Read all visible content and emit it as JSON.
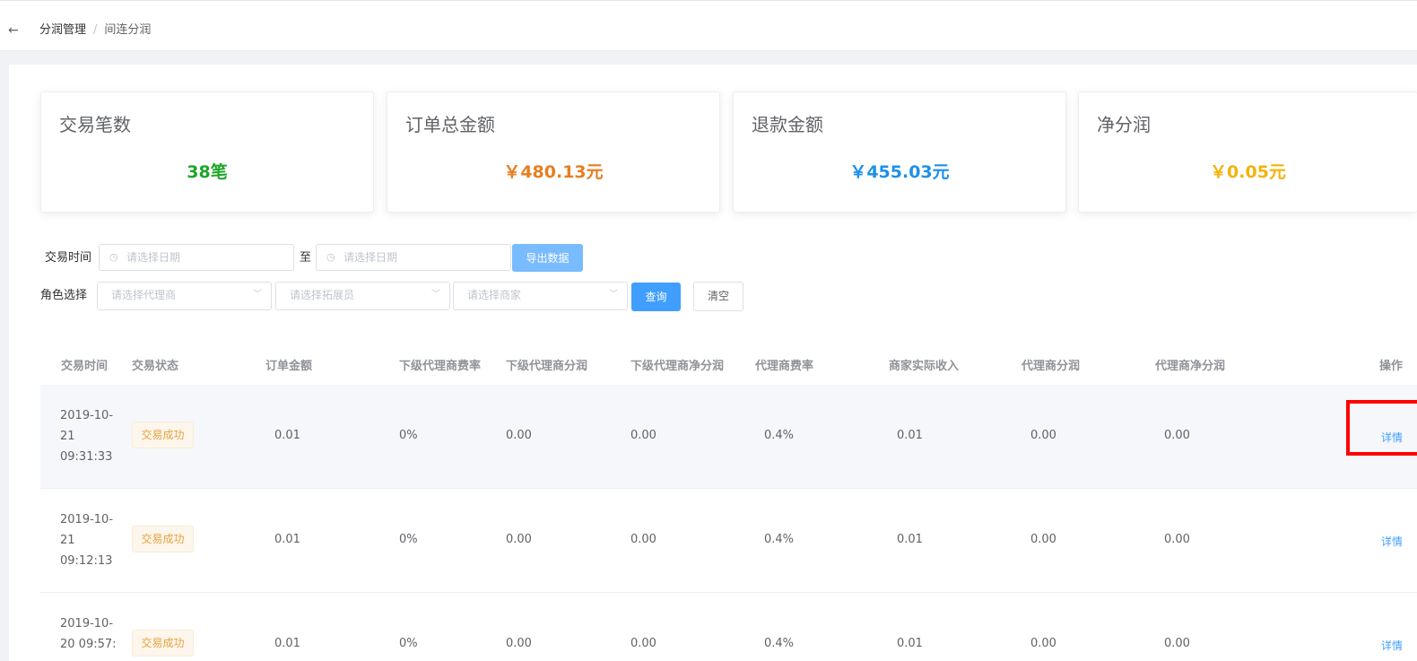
{
  "breadcrumb": {
    "back_icon": "←",
    "parent": "分润管理",
    "separator": "/",
    "current": "间连分润"
  },
  "stats": [
    {
      "title": "交易笔数",
      "value": "38笔",
      "color": "#1ca626"
    },
    {
      "title": "订单总金额",
      "value": "￥480.13元",
      "color": "#e67e22"
    },
    {
      "title": "退款金额",
      "value": "￥455.03元",
      "color": "#1e90e8"
    },
    {
      "title": "净分润",
      "value": "￥0.05元",
      "color": "#f2b30c"
    }
  ],
  "filters": {
    "time_label": "交易时间",
    "start_placeholder": "请选择日期",
    "to_label": "至",
    "end_placeholder": "请选择日期",
    "export_label": "导出数据",
    "role_label": "角色选择",
    "agent_placeholder": "请选择代理商",
    "promoter_placeholder": "请选择拓展员",
    "merchant_placeholder": "请选择商家",
    "query_label": "查询",
    "clear_label": "清空"
  },
  "table": {
    "headers": [
      "交易时间",
      "交易状态",
      "订单金额",
      "下级代理商费率",
      "下级代理商分润",
      "下级代理商净分润",
      "代理商费率",
      "商家实际收入",
      "代理商分润",
      "代理商净分润",
      "操作"
    ],
    "rows": [
      {
        "time": "2019-10-21 09:31:33",
        "status": "交易成功",
        "amount": "0.01",
        "sub_rate": "0%",
        "sub_profit": "0.00",
        "sub_net": "0.00",
        "agent_rate": "0.4%",
        "merchant_income": "0.01",
        "agent_profit": "0.00",
        "agent_net": "0.00",
        "action": "详情"
      },
      {
        "time": "2019-10-21 09:12:13",
        "status": "交易成功",
        "amount": "0.01",
        "sub_rate": "0%",
        "sub_profit": "0.00",
        "sub_net": "0.00",
        "agent_rate": "0.4%",
        "merchant_income": "0.01",
        "agent_profit": "0.00",
        "agent_net": "0.00",
        "action": "详情"
      },
      {
        "time": "2019-10-20 09:57:",
        "status": "交易成功",
        "amount": "0.01",
        "sub_rate": "0%",
        "sub_profit": "0.00",
        "sub_net": "0.00",
        "agent_rate": "0.4%",
        "merchant_income": "0.01",
        "agent_profit": "0.00",
        "agent_net": "0.00",
        "action": "详情"
      }
    ]
  }
}
